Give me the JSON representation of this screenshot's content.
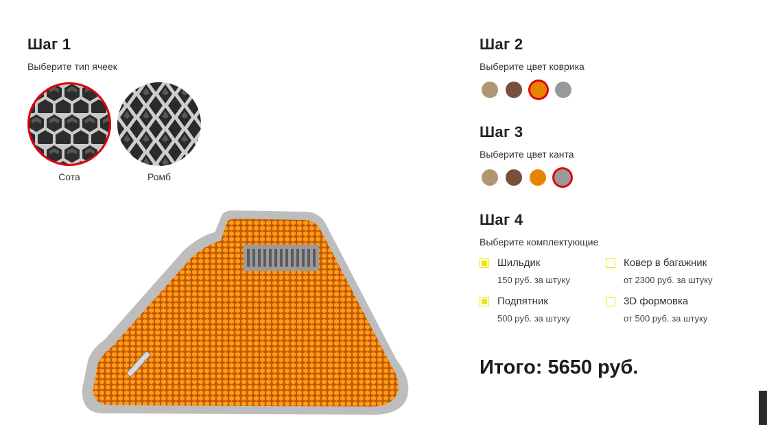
{
  "step1": {
    "title": "Шаг 1",
    "subtitle": "Выберите тип ячеек",
    "options": [
      {
        "label": "Сота",
        "selected": true
      },
      {
        "label": "Ромб",
        "selected": false
      }
    ]
  },
  "step2": {
    "title": "Шаг 2",
    "subtitle": "Выберите цвет коврика",
    "colors": [
      {
        "name": "beige",
        "hex": "#b09672"
      },
      {
        "name": "brown",
        "hex": "#7a4f3a"
      },
      {
        "name": "orange",
        "hex": "#e48400",
        "selected": true
      },
      {
        "name": "grey",
        "hex": "#999999"
      }
    ]
  },
  "step3": {
    "title": "Шаг 3",
    "subtitle": "Выберите цвет канта",
    "colors": [
      {
        "name": "beige",
        "hex": "#b09672"
      },
      {
        "name": "brown",
        "hex": "#7a4f3a"
      },
      {
        "name": "orange",
        "hex": "#e48400"
      },
      {
        "name": "grey",
        "hex": "#999999",
        "selected": true
      }
    ]
  },
  "step4": {
    "title": "Шаг 4",
    "subtitle": "Выберите комплектующие",
    "items": [
      {
        "name": "Шильдик",
        "price": "150 руб. за штуку",
        "checked": true
      },
      {
        "name": "Ковер в багажник",
        "price": "от 2300 руб. за штуку",
        "checked": false
      },
      {
        "name": "Подпятник",
        "price": "500 руб. за штуку",
        "checked": true
      },
      {
        "name": "3D формовка",
        "price": "от 500 руб. за штуку",
        "checked": false
      }
    ]
  },
  "total": {
    "label": "Итого:",
    "value": "5650 руб."
  },
  "accent_color": "#e3000f",
  "checkbox_color": "#f1e600"
}
